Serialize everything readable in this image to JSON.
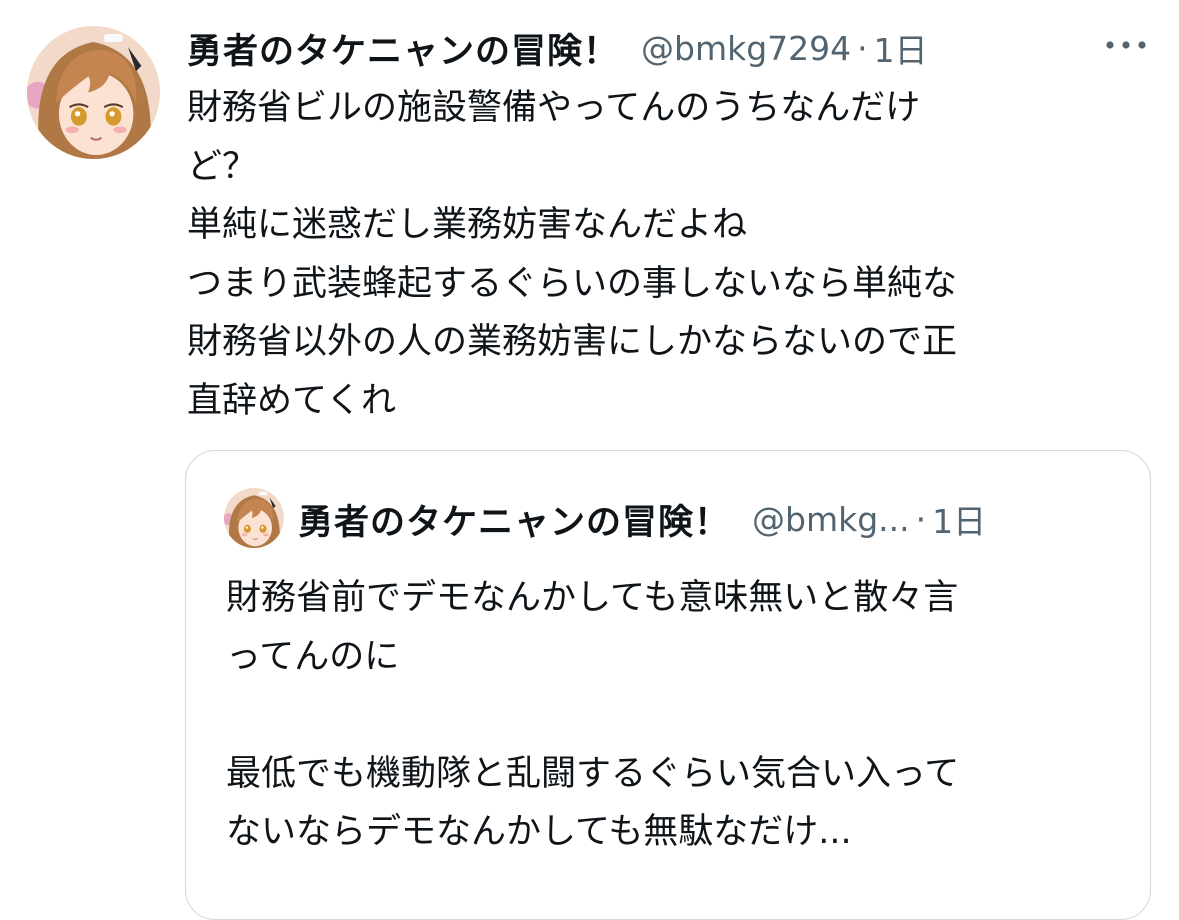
{
  "tweet": {
    "author": {
      "display_name": "勇者のタケニャンの冒険！",
      "handle": "@bmkg7294",
      "avatar": "anime-girl-avatar"
    },
    "separator": "·",
    "timestamp": "1日",
    "more_icon": "more-horizontal-icon",
    "text_lines": [
      "財務省ビルの施設警備やってんのうちなんだけ",
      "ど？",
      "単純に迷惑だし業務妨害なんだよね",
      "つまり武装蜂起するぐらいの事しないなら単純な",
      "財務省以外の人の業務妨害にしかならないので正",
      "直辞めてくれ"
    ]
  },
  "quoted_tweet": {
    "author": {
      "display_name": "勇者のタケニャンの冒険！",
      "handle": "@bmkg...",
      "avatar": "anime-girl-avatar"
    },
    "separator": "·",
    "timestamp": "1日",
    "text_lines": [
      "財務省前でデモなんかしても意味無いと散々言",
      "ってんのに",
      "",
      "最低でも機動隊と乱闘するぐらい気合い入って",
      "ないならデモなんかしても無駄なだけ..."
    ]
  },
  "colors": {
    "text_primary": "#0f1419",
    "text_secondary": "#536471",
    "border": "#cfd9de"
  }
}
